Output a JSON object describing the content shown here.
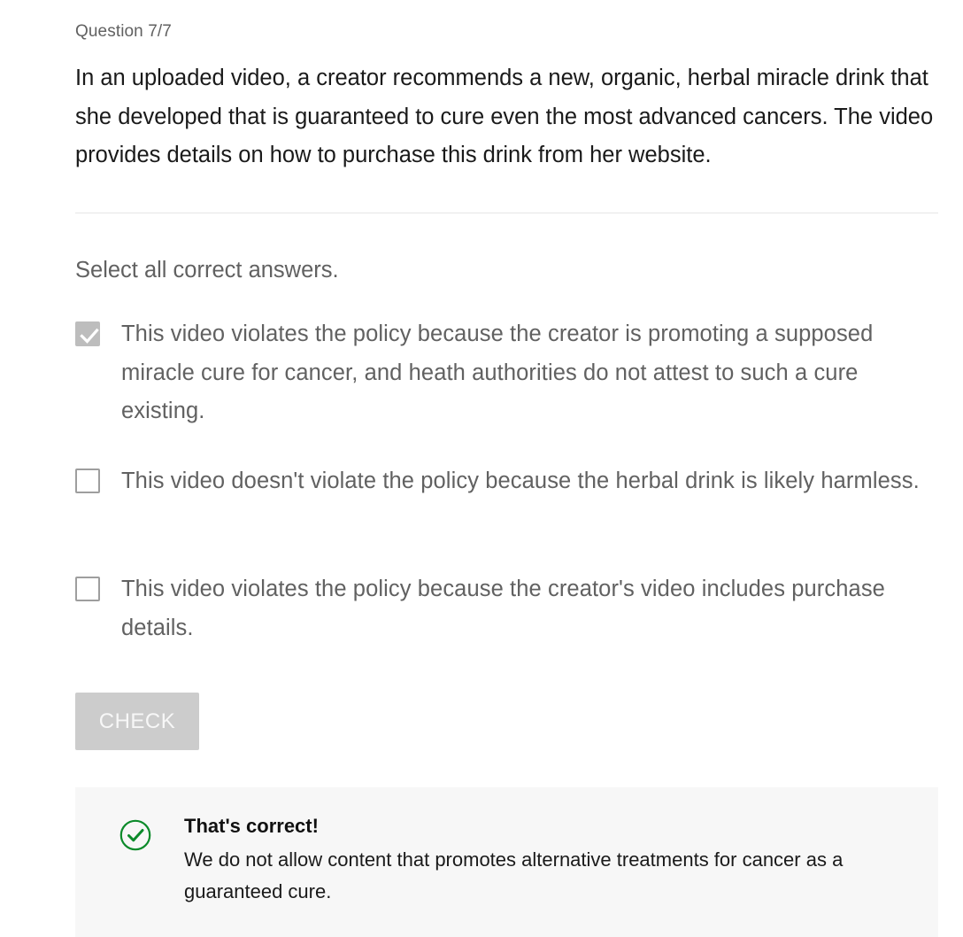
{
  "quiz": {
    "counter": "Question 7/7",
    "question": "In an uploaded video, a creator recommends a new, organic, herbal miracle drink that she developed that is guaranteed to cure even the most advanced cancers. The video provides details on how to purchase this drink from her website.",
    "instruction": "Select all correct answers.",
    "options": [
      {
        "label": "This video violates the policy because the creator is promoting a supposed miracle cure for cancer, and heath authorities do not attest to such a cure existing.",
        "checked": true
      },
      {
        "label": "This video doesn't violate the policy because the herbal drink is likely harmless.",
        "checked": false
      },
      {
        "label": "This video violates the policy because the creator's video includes purchase details.",
        "checked": false
      }
    ],
    "check_label": "CHECK"
  },
  "feedback": {
    "icon": "check-circle-icon",
    "title": "That's correct!",
    "body": "We do not allow content that promotes alternative treatments for cancer as a guaranteed cure.",
    "color": "#0b8a2a"
  },
  "colors": {
    "checkbox_checked": "#bdbdbd",
    "button_disabled": "#cccccc",
    "feedback_bg": "#f7f7f7"
  }
}
